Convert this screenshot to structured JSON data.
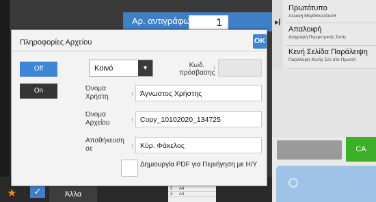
{
  "background": {
    "copies": {
      "label": "Αρ. αντιγράφων",
      "value": "1"
    },
    "right_menu": [
      {
        "title": "Πρωτότυπο",
        "subtitle": "Αλλαγή Μεγέθους/Διεύθ"
      },
      {
        "title": "Απαλοιφή",
        "subtitle": "Διαγραφή Περιμετρικής Σκιάς"
      },
      {
        "title": "Κενή Σελίδα Παράλειψη",
        "subtitle": "Παράλειψη Κενής Σελ στο Πρωτότ"
      }
    ],
    "ca_label": "CA",
    "bottom": {
      "other_label": "Άλλα",
      "list_rows": [
        {
          "num": "3",
          "size": "A4"
        },
        {
          "num": "4",
          "size": "A4"
        }
      ]
    },
    "colors": {
      "accent": "#3d85d6",
      "ca_green": "#3fae2a",
      "star": "#f08a1e"
    }
  },
  "dialog": {
    "title": "Πληροφορίες Αρχείου",
    "ok_label": "OK",
    "toggle": {
      "off_label": "Off",
      "on_label": "On",
      "selected": "Off"
    },
    "mode_select": {
      "value": "Κοινό"
    },
    "password": {
      "label": "Κωδ. πρόσβασης",
      "value": ""
    },
    "fields": [
      {
        "label": "Όνομα Χρήστη",
        "value": "Άγνωστος Χρήστης"
      },
      {
        "label": "Όνομα Αρχείου",
        "value": "Copy_10102020_134725"
      },
      {
        "label": "Αποθήκευση σε",
        "value": "Κύρ. Φάκελος"
      }
    ],
    "pdf_preview": {
      "label": "Δημιουργία PDF για Περιήγηση με Η/Υ",
      "checked": false
    }
  }
}
